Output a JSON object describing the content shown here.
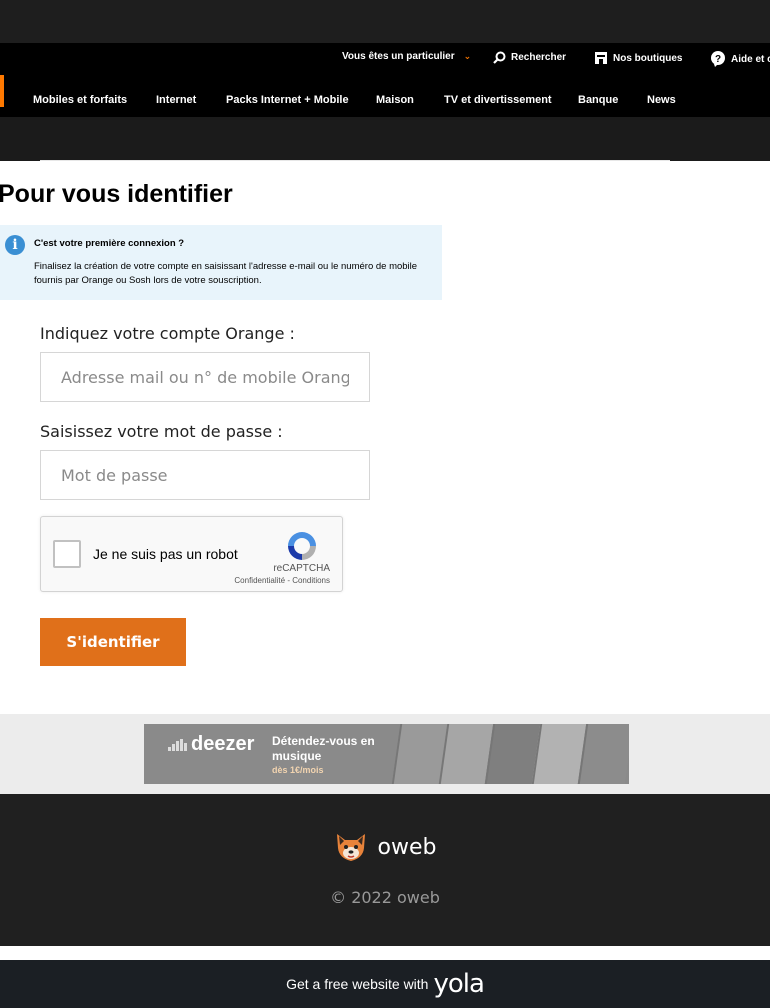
{
  "header": {
    "util": {
      "profile_label": "Vous êtes un particulier",
      "search_label": "Rechercher",
      "shops_label": "Nos boutiques",
      "help_label": "Aide et c"
    },
    "nav": [
      "Mobiles et forfaits",
      "Internet",
      "Packs Internet + Mobile",
      "Maison",
      "TV et divertissement",
      "Banque",
      "News"
    ],
    "accent_color": "#ff7900"
  },
  "main": {
    "title": "Pour vous identifier",
    "info": {
      "title": "C'est votre première connexion ?",
      "text": "Finalisez la création de votre compte en saisissant l'adresse e-mail ou le numéro de mobile fournis par Orange ou Sosh lors de votre souscription.",
      "icon": "info-icon"
    },
    "account_label": "Indiquez votre compte Orange :",
    "account_placeholder": "Adresse mail ou n° de mobile Orange",
    "account_value": "",
    "password_label": "Saisissez votre mot de passe :",
    "password_placeholder": "Mot de passe",
    "password_value": "",
    "captcha": {
      "label": "Je ne suis pas un robot",
      "brand": "reCAPTCHA",
      "links": "Confidentialité - Conditions",
      "checked": false
    },
    "submit_label": "S'identifier",
    "button_color": "#e0701a"
  },
  "banner": {
    "brand": "deezer",
    "headline": "Détendez-vous en musique",
    "price": "dès 1€/mois"
  },
  "footer": {
    "brand_name": "oweb",
    "copyright": "© 2022 oweb"
  },
  "yola": {
    "text": "Get a free website with",
    "logo_text": "yola"
  }
}
